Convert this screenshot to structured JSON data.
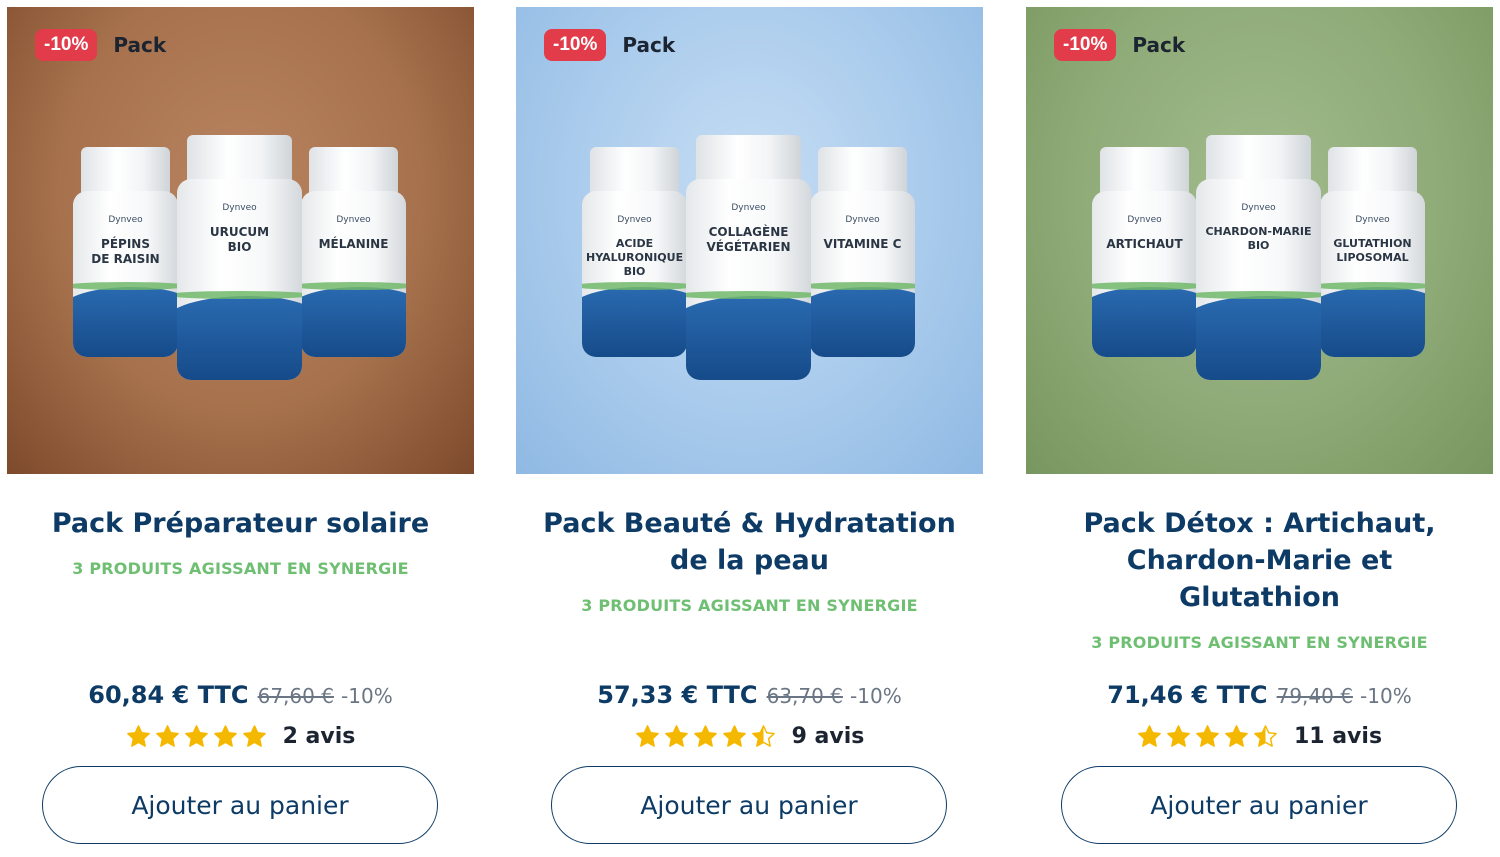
{
  "products": [
    {
      "discount_badge": "-10%",
      "type_badge": "Pack",
      "title": "Pack Préparateur solaire",
      "subtitle": "3 PRODUITS AGISSANT EN SYNERGIE",
      "price": "60,84 € TTC",
      "old_price": "67,60 €",
      "discount_text": "-10%",
      "rating": 5,
      "reviews": "2 avis",
      "cta": "Ajouter au panier",
      "bottles": [
        {
          "brand": "Dynveo",
          "label": "PÉPINS\nDE RAISIN"
        },
        {
          "brand": "Dynveo",
          "label": "URUCUM\nBIO"
        },
        {
          "brand": "Dynveo",
          "label": "MÉLANINE"
        }
      ]
    },
    {
      "discount_badge": "-10%",
      "type_badge": "Pack",
      "title": "Pack Beauté & Hydratation de la peau",
      "subtitle": "3 PRODUITS AGISSANT EN SYNERGIE",
      "price": "57,33 € TTC",
      "old_price": "63,70 €",
      "discount_text": "-10%",
      "rating": 4.5,
      "reviews": "9 avis",
      "cta": "Ajouter au panier",
      "bottles": [
        {
          "brand": "Dynveo",
          "label": "ACIDE\nHYALURONIQUE\nBIO"
        },
        {
          "brand": "Dynveo",
          "label": "COLLAGÈNE\nVÉGÉTARIEN"
        },
        {
          "brand": "Dynveo",
          "label": "VITAMINE C"
        }
      ]
    },
    {
      "discount_badge": "-10%",
      "type_badge": "Pack",
      "title": "Pack Détox : Artichaut, Chardon-Marie et Glutathion",
      "subtitle": "3 PRODUITS AGISSANT EN SYNERGIE",
      "price": "71,46 € TTC",
      "old_price": "79,40 €",
      "discount_text": "-10%",
      "rating": 4.5,
      "reviews": "11 avis",
      "cta": "Ajouter au panier",
      "bottles": [
        {
          "brand": "Dynveo",
          "label": "ARTICHAUT"
        },
        {
          "brand": "Dynveo",
          "label": "CHARDON-MARIE\nBIO"
        },
        {
          "brand": "Dynveo",
          "label": "GLUTATHION\nLIPOSOMAL"
        }
      ]
    }
  ],
  "colors": {
    "primary": "#0d3b66",
    "accent_green": "#6fbf73",
    "badge_red": "#e23b4a",
    "star_gold": "#f5b800"
  }
}
